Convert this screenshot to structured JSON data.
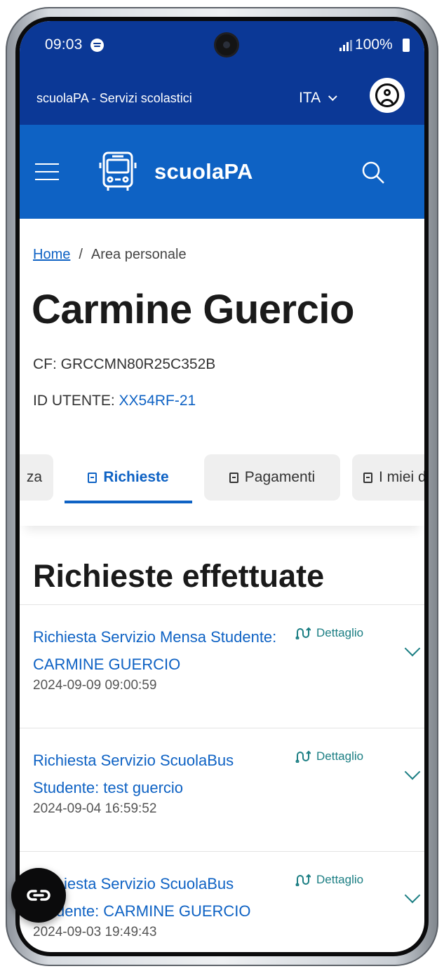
{
  "status_bar": {
    "time": "09:03",
    "battery": "100%"
  },
  "header": {
    "site_title": "scuolaPA - Servizi scolastici",
    "language": "ITA",
    "brand": "scuolaPA"
  },
  "breadcrumb": {
    "home": "Home",
    "separator": "/",
    "current": "Area personale"
  },
  "profile": {
    "name": "Carmine Guercio",
    "cf_label": "CF:",
    "cf_value": "GRCCMN80R25C352B",
    "id_label": "ID UTENTE:",
    "id_value": "XX54RF-21"
  },
  "tabs": [
    {
      "label": "za",
      "active": false
    },
    {
      "label": "Richieste",
      "active": true
    },
    {
      "label": "Pagamenti",
      "active": false
    },
    {
      "label": "I miei d",
      "active": false
    }
  ],
  "section_title": "Richieste effettuate",
  "requests": [
    {
      "title": "Richiesta Servizio Mensa Studente: CARMINE GUERCIO",
      "date": "2024-09-09 09:00:59",
      "detail_label": "Dettaglio"
    },
    {
      "title": "Richiesta Servizio ScuolaBus Studente: test guercio",
      "date": "2024-09-04 16:59:52",
      "detail_label": "Dettaglio"
    },
    {
      "title": "Richiesta Servizio ScuolaBus Studente: CARMINE GUERCIO",
      "date": "2024-09-03 19:49:43",
      "detail_label": "Dettaglio"
    }
  ],
  "colors": {
    "header_dark": "#0b3896",
    "header_primary": "#0e62c4",
    "link": "#0e62c4",
    "detail_accent": "#1b7e83"
  },
  "icons": [
    "spotify-icon",
    "signal-icon",
    "battery-icon",
    "user-icon",
    "hamburger-icon",
    "bus-icon",
    "search-icon",
    "doc-icon",
    "route-icon",
    "chevron-down-icon",
    "accessibility-icon"
  ]
}
